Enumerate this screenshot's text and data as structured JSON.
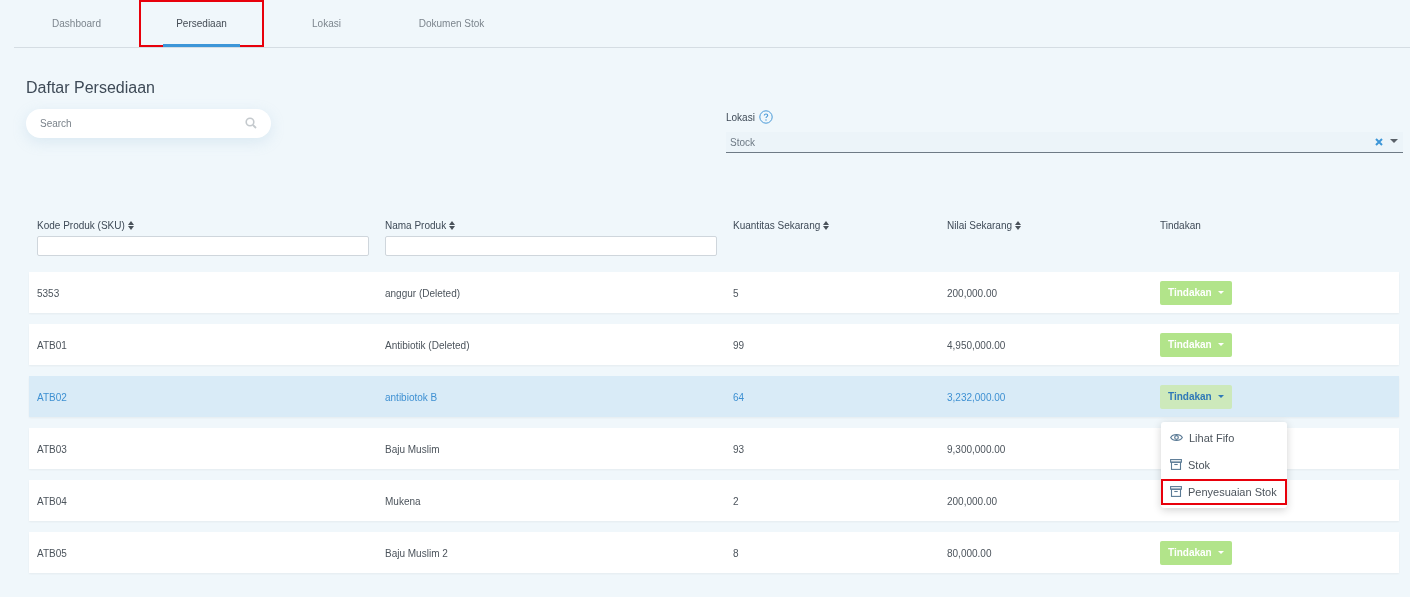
{
  "tabs": [
    {
      "label": "Dashboard",
      "selected": false,
      "highlighted": false
    },
    {
      "label": "Persediaan",
      "selected": true,
      "highlighted": true
    },
    {
      "label": "Lokasi",
      "selected": false,
      "highlighted": false
    },
    {
      "label": "Dokumen Stok",
      "selected": false,
      "highlighted": false
    }
  ],
  "title": "Daftar Persediaan",
  "search": {
    "placeholder": "Search"
  },
  "location": {
    "label": "Lokasi",
    "value": "Stock"
  },
  "table": {
    "columns": [
      {
        "label": "Kode Produk (SKU)",
        "sortable": true,
        "filter": true
      },
      {
        "label": "Nama Produk",
        "sortable": true,
        "filter": true
      },
      {
        "label": "Kuantitas Sekarang",
        "sortable": true,
        "filter": false
      },
      {
        "label": "Nilai Sekarang",
        "sortable": true,
        "filter": false
      },
      {
        "label": "Tindakan",
        "sortable": false,
        "filter": false
      }
    ],
    "rows": [
      {
        "cells": [
          "5353",
          "anggur (Deleted)",
          "5",
          "200,000.00"
        ],
        "action": "Tindakan",
        "selected": false
      },
      {
        "cells": [
          "ATB01",
          "Antibiotik (Deleted)",
          "99",
          "4,950,000.00"
        ],
        "action": "Tindakan",
        "selected": false
      },
      {
        "cells": [
          "ATB02",
          "antibiotok B",
          "64",
          "3,232,000.00"
        ],
        "action": "Tindakan",
        "selected": true
      },
      {
        "cells": [
          "ATB03",
          "Baju Muslim",
          "93",
          "9,300,000.00"
        ],
        "selected": false
      },
      {
        "cells": [
          "ATB04",
          "Mukena",
          "2",
          "200,000.00"
        ],
        "selected": false
      },
      {
        "cells": [
          "ATB05",
          "Baju Muslim 2",
          "8",
          "80,000.00"
        ],
        "action": "Tindakan",
        "selected": false
      }
    ]
  },
  "action_menu": {
    "items": [
      {
        "kind": "eye",
        "label": "Lihat Fifo",
        "highlighted": false
      },
      {
        "kind": "box",
        "label": "Stok",
        "highlighted": false
      },
      {
        "kind": "box",
        "label": "Penyesuaian Stok",
        "highlighted": true
      }
    ]
  }
}
